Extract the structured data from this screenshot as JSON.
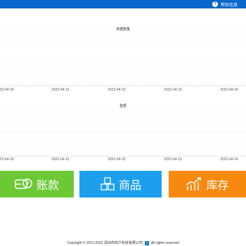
{
  "header": {
    "help_label": "帮助信息",
    "help_icon_glyph": "?"
  },
  "panels": [
    {
      "title": "单据数量",
      "dates": [
        "2022-04-20",
        "2022-04-21",
        "2022-04-22",
        "2022-04-23",
        "2022-04-24"
      ]
    },
    {
      "title": "金额",
      "dates": [
        "2022-04-20",
        "2022-04-21",
        "2022-04-22",
        "2022-04-23",
        "2022-04-24"
      ]
    }
  ],
  "tiles": {
    "account": {
      "label": "账款",
      "color": "#6cc935",
      "icon": "account-icon"
    },
    "goods": {
      "label": "商品",
      "color": "#1ca0ee",
      "icon": "boxes-icon"
    },
    "stock": {
      "label": "库存",
      "color": "#f7890f",
      "icon": "trend-chart-icon"
    }
  },
  "footer": {
    "copyright": "Copyright © 2011-2022 深圳市商户科技有限公司",
    "rights": "All rights reserved"
  }
}
